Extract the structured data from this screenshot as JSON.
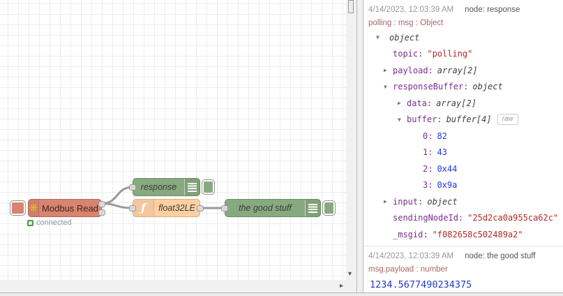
{
  "canvas": {
    "nodes": {
      "modbus": {
        "label": "Modbus Read",
        "status": "connected",
        "icon": "❋"
      },
      "response": {
        "label": "response"
      },
      "func": {
        "label": "float32LE",
        "icon": "ƒ"
      },
      "good_stuff": {
        "label": "the good stuff"
      }
    },
    "scrollbars": {
      "down_arrow": "▾",
      "right_arrow": "▸"
    }
  },
  "sidebar": {
    "messages": [
      {
        "timestamp": "4/14/2023, 12:03:39 AM",
        "node": "node: response",
        "topic": "polling : msg : Object",
        "tree": [
          {
            "arrow": "▼",
            "key": "",
            "value": "object",
            "type": "meta",
            "level": 0
          },
          {
            "arrow": "",
            "key": "topic:",
            "value": "\"polling\"",
            "type": "string",
            "level": 1
          },
          {
            "arrow": "▶",
            "key": "payload:",
            "value": "array[2]",
            "type": "meta",
            "level": 1
          },
          {
            "arrow": "▼",
            "key": "responseBuffer:",
            "value": "object",
            "type": "meta",
            "level": 1
          },
          {
            "arrow": "▶",
            "key": "data:",
            "value": "array[2]",
            "type": "meta",
            "level": 2
          },
          {
            "arrow": "▼",
            "key": "buffer:",
            "value": "buffer[4]",
            "type": "meta",
            "level": 2,
            "button": "raw"
          },
          {
            "arrow": "",
            "key": "0:",
            "value": "82",
            "type": "number",
            "level": 3
          },
          {
            "arrow": "",
            "key": "1:",
            "value": "43",
            "type": "number",
            "level": 3
          },
          {
            "arrow": "",
            "key": "2:",
            "value": "0x44",
            "type": "number",
            "level": 3
          },
          {
            "arrow": "",
            "key": "3:",
            "value": "0x9a",
            "type": "number",
            "level": 3
          },
          {
            "arrow": "▶",
            "key": "input:",
            "value": "object",
            "type": "meta",
            "level": 1
          },
          {
            "arrow": "",
            "key": "sendingNodeId:",
            "value": "\"25d2ca0a955ca62c\"",
            "type": "string",
            "level": 1
          },
          {
            "arrow": "",
            "key": "_msgid:",
            "value": "\"f082658c502489a2\"",
            "type": "string",
            "level": 1
          }
        ]
      },
      {
        "timestamp": "4/14/2023, 12:03:39 AM",
        "node": "node: the good stuff",
        "topic": "msg.payload : number",
        "value": "1234.5677490234375"
      }
    ]
  },
  "colors": {
    "modbus_node": "#d8846f",
    "debug_node": "#87a980",
    "function_node": "#fdd0a2",
    "wire": "#999999",
    "tree_key": "#792e90",
    "tree_string": "#b22828",
    "tree_number": "#2336d2",
    "topic_meta": "#aa6666",
    "status_green": "#4a9a4a"
  }
}
